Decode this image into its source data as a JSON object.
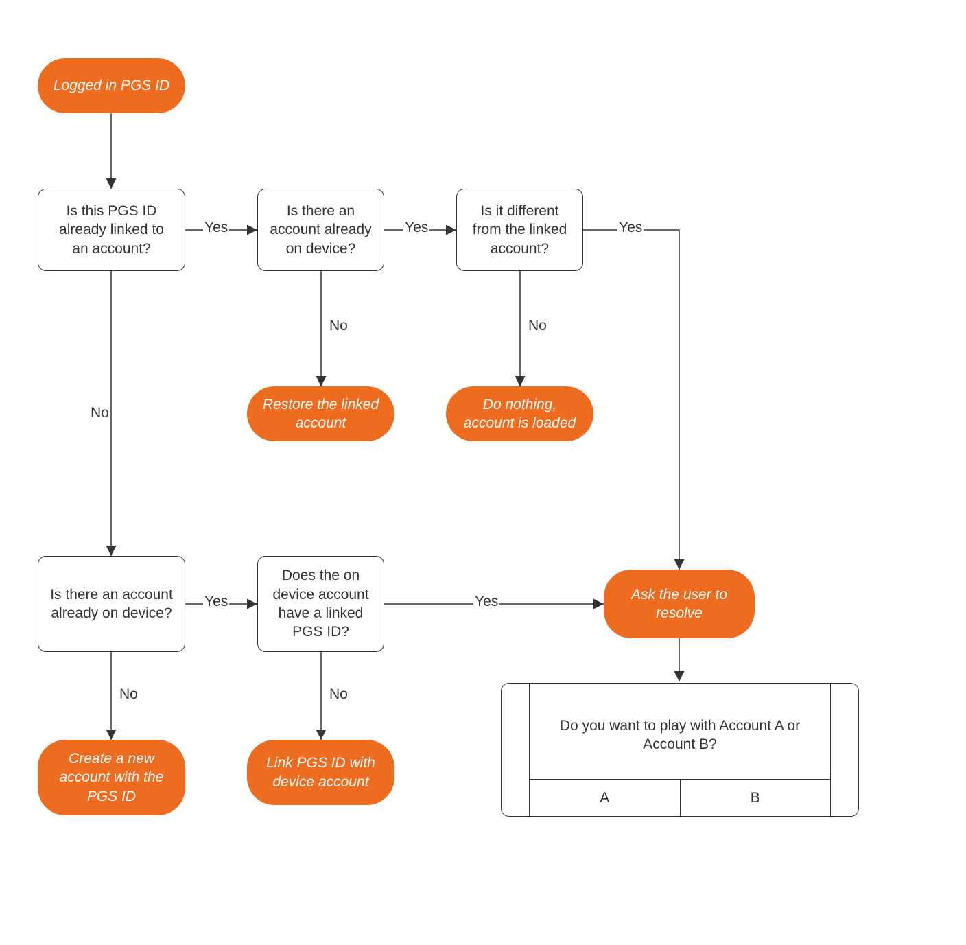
{
  "colors": {
    "accent": "#ed6c1f",
    "stroke": "#333333",
    "bg": "#ffffff"
  },
  "nodes": {
    "start": "Logged in PGS ID",
    "q1": "Is this PGS ID already linked to an account?",
    "q2": "Is there an account already on device?",
    "q3": "Is it different from the linked account?",
    "t_restore": "Restore the linked account",
    "t_nothing": "Do nothing, account is loaded",
    "q4": "Is there an account already on device?",
    "q5": "Does the on device account have a linked PGS ID?",
    "t_create": "Create a new account with the PGS  ID",
    "t_link": "Link PGS ID with device account",
    "t_resolve": "Ask the user to resolve",
    "resolve_prompt": "Do you want to play with Account A or Account B?",
    "resolve_a": "A",
    "resolve_b": "B"
  },
  "edges": {
    "yes": "Yes",
    "no": "No"
  }
}
